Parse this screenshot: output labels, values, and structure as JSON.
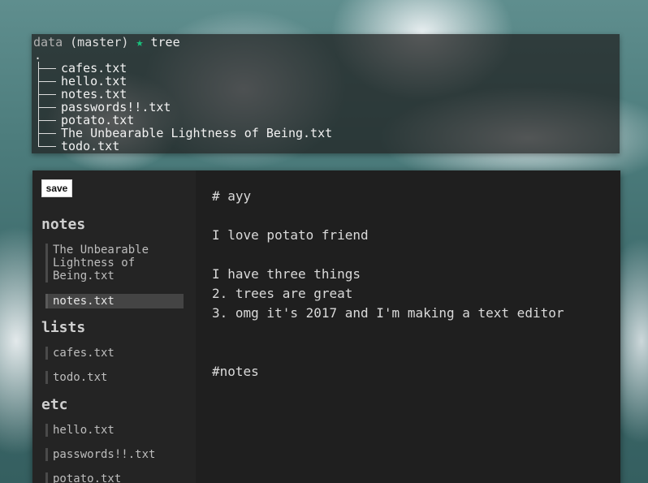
{
  "terminal": {
    "prompt": {
      "dir": "data",
      "branch": "(master)",
      "star": "★",
      "command": "tree"
    },
    "root": ".",
    "files": [
      "cafes.txt",
      "hello.txt",
      "notes.txt",
      "passwords!!.txt",
      "potato.txt",
      "The Unbearable Lightness of Being.txt",
      "todo.txt"
    ]
  },
  "editor": {
    "save_label": "save",
    "groups": [
      {
        "title": "notes",
        "items": [
          "The Unbearable Lightness of Being.txt",
          "notes.txt"
        ]
      },
      {
        "title": "lists",
        "items": [
          "cafes.txt",
          "todo.txt"
        ]
      },
      {
        "title": "etc",
        "items": [
          "hello.txt",
          "passwords!!.txt",
          "potato.txt"
        ]
      }
    ],
    "active_item": "notes.txt",
    "content_lines": [
      "# ayy",
      "",
      "I love potato friend",
      "",
      "I have three things",
      "2. trees are great",
      "3. omg it's 2017 and I'm making a text editor",
      "",
      "",
      "#notes"
    ]
  },
  "colors": {
    "star": "#19c37d",
    "active_item_bg": "#444444",
    "editor_bg": "#1f1f1f",
    "sidebar_bg": "#242424"
  }
}
